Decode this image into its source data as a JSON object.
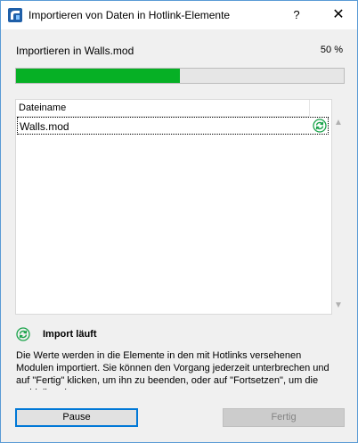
{
  "window": {
    "title": "Importieren von Daten in Hotlink-Elemente",
    "help_label": "?",
    "close_label": "✕"
  },
  "progress": {
    "label": "Importieren in Walls.mod",
    "percent_text": "50 %",
    "value": 0.5,
    "fill_color": "#06b025"
  },
  "file_list": {
    "column_header": "Dateiname",
    "rows": [
      {
        "name": "Walls.mod",
        "status_icon": "sync-icon"
      }
    ]
  },
  "status": {
    "icon": "sync-icon",
    "label": "Import läuft",
    "description": "Die Werte werden in die Elemente in den mit Hotlinks versehenen Modulen importiert. Sie können den Vorgang jederzeit unterbrechen und auf \"Fertig\" klicken, um ihn zu beenden, oder auf \"Fortsetzen\", um die verbleibenden"
  },
  "buttons": {
    "pause": "Pause",
    "finish": "Fertig"
  },
  "colors": {
    "accent": "#0078d7",
    "sync_icon": "#1aa34a"
  }
}
